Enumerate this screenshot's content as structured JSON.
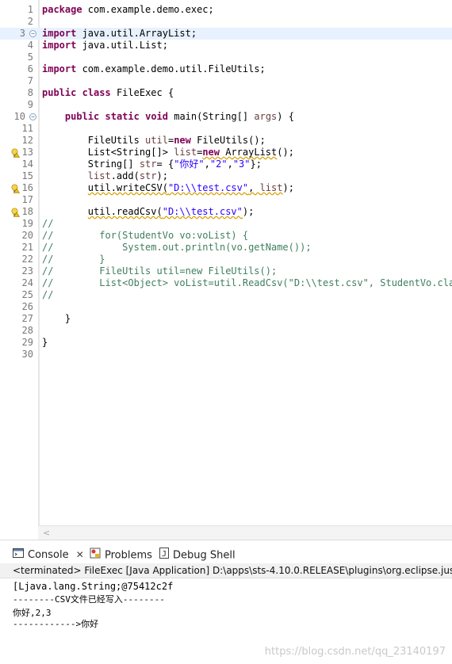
{
  "editor": {
    "lines": [
      {
        "num": "1",
        "code": [
          {
            "t": "package",
            "c": "kw"
          },
          {
            "t": " com.example.demo.exec;"
          }
        ]
      },
      {
        "num": "2",
        "code": []
      },
      {
        "num": "3",
        "fold": "−",
        "hl": true,
        "code": [
          {
            "t": "import",
            "c": "kw"
          },
          {
            "t": " java.util.ArrayList;"
          }
        ]
      },
      {
        "num": "4",
        "code": [
          {
            "t": "import",
            "c": "kw"
          },
          {
            "t": " java.util.List;"
          }
        ]
      },
      {
        "num": "5",
        "code": []
      },
      {
        "num": "6",
        "code": [
          {
            "t": "import",
            "c": "kw"
          },
          {
            "t": " com.example.demo.util.FileUtils;"
          }
        ]
      },
      {
        "num": "7",
        "code": []
      },
      {
        "num": "8",
        "code": [
          {
            "t": "public",
            "c": "kw"
          },
          {
            "t": " "
          },
          {
            "t": "class",
            "c": "kw"
          },
          {
            "t": " FileExec {"
          }
        ]
      },
      {
        "num": "9",
        "code": []
      },
      {
        "num": "10",
        "fold": "−",
        "code": [
          {
            "t": "    "
          },
          {
            "t": "public",
            "c": "kw"
          },
          {
            "t": " "
          },
          {
            "t": "static",
            "c": "kw"
          },
          {
            "t": " "
          },
          {
            "t": "void",
            "c": "kw"
          },
          {
            "t": " main(String[] "
          },
          {
            "t": "args",
            "c": "fld"
          },
          {
            "t": ") {"
          }
        ]
      },
      {
        "num": "11",
        "code": []
      },
      {
        "num": "12",
        "code": [
          {
            "t": "        FileUtils "
          },
          {
            "t": "util",
            "c": "fld"
          },
          {
            "t": "="
          },
          {
            "t": "new",
            "c": "kw"
          },
          {
            "t": " FileUtils();"
          }
        ]
      },
      {
        "num": "13",
        "warn": true,
        "code": [
          {
            "t": "        List<String[]> "
          },
          {
            "t": "list",
            "c": "fld"
          },
          {
            "t": "="
          },
          {
            "t": "new",
            "c": "kw sq"
          },
          {
            "t": " ArrayList",
            "c": "sq"
          },
          {
            "t": "();"
          }
        ]
      },
      {
        "num": "14",
        "code": [
          {
            "t": "        String[] "
          },
          {
            "t": "str",
            "c": "fld"
          },
          {
            "t": "= {"
          },
          {
            "t": "\"你好\"",
            "c": "str"
          },
          {
            "t": ","
          },
          {
            "t": "\"2\"",
            "c": "str"
          },
          {
            "t": ","
          },
          {
            "t": "\"3\"",
            "c": "str"
          },
          {
            "t": "};"
          }
        ]
      },
      {
        "num": "15",
        "code": [
          {
            "t": "        "
          },
          {
            "t": "list",
            "c": "fld"
          },
          {
            "t": ".add("
          },
          {
            "t": "str",
            "c": "fld"
          },
          {
            "t": ");"
          }
        ]
      },
      {
        "num": "16",
        "warn": true,
        "code": [
          {
            "t": "        "
          },
          {
            "t": "util.writeCSV(",
            "c": "sq"
          },
          {
            "t": "\"D:\\\\test.csv\"",
            "c": "str sq"
          },
          {
            "t": ", ",
            "c": "sq"
          },
          {
            "t": "list",
            "c": "fld sq"
          },
          {
            "t": ");"
          }
        ]
      },
      {
        "num": "17",
        "code": []
      },
      {
        "num": "18",
        "warn": true,
        "code": [
          {
            "t": "        "
          },
          {
            "t": "util.readCsv(",
            "c": "sq"
          },
          {
            "t": "\"D:\\\\test.csv\"",
            "c": "str sq"
          },
          {
            "t": ");"
          }
        ]
      },
      {
        "num": "19",
        "code": [
          {
            "t": "//",
            "c": "cm"
          }
        ]
      },
      {
        "num": "20",
        "code": [
          {
            "t": "//        for(StudentVo vo:voList) {",
            "c": "cm"
          }
        ]
      },
      {
        "num": "21",
        "code": [
          {
            "t": "//            System.out.println(vo.getName());",
            "c": "cm"
          }
        ]
      },
      {
        "num": "22",
        "code": [
          {
            "t": "//        }",
            "c": "cm"
          }
        ]
      },
      {
        "num": "23",
        "code": [
          {
            "t": "//        FileUtils util=new FileUtils();",
            "c": "cm"
          }
        ]
      },
      {
        "num": "24",
        "code": [
          {
            "t": "//        List<Object> voList=util.ReadCsv(\"D:\\\\test.csv\", StudentVo.class);",
            "c": "cm"
          }
        ]
      },
      {
        "num": "25",
        "code": [
          {
            "t": "//",
            "c": "cm"
          }
        ]
      },
      {
        "num": "26",
        "code": []
      },
      {
        "num": "27",
        "code": [
          {
            "t": "    }"
          }
        ]
      },
      {
        "num": "28",
        "code": []
      },
      {
        "num": "29",
        "code": [
          {
            "t": "}"
          }
        ]
      },
      {
        "num": "30",
        "code": []
      }
    ]
  },
  "console": {
    "tabs": {
      "console": "Console",
      "problems": "Problems",
      "debug_shell": "Debug Shell"
    },
    "status": "<terminated> FileExec [Java Application] D:\\apps\\sts-4.10.0.RELEASE\\plugins\\org.eclipse.justj.openjdk",
    "output": [
      "[Ljava.lang.String;@75412c2f",
      "--------CSV文件已经写入--------",
      "你好,2,3",
      "------------>你好"
    ]
  },
  "watermark": "https://blog.csdn.net/qq_23140197",
  "colors": {
    "keyword": "#7f0055",
    "string": "#2a00ff",
    "comment": "#3f7f5f",
    "field": "#6a3e3e",
    "current_line": "#e8f2fe"
  }
}
